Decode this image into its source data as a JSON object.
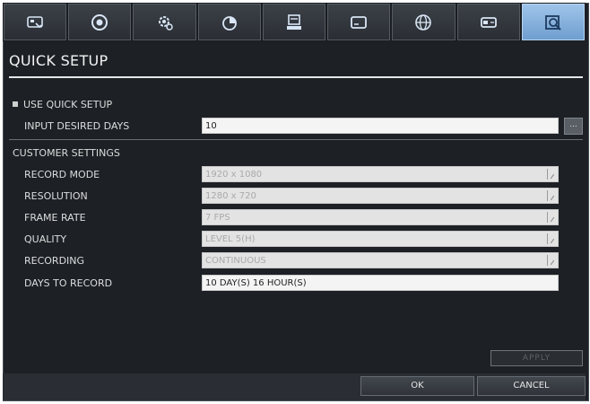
{
  "tabs": [
    {
      "icon": "camera-setup-icon"
    },
    {
      "icon": "record-icon"
    },
    {
      "icon": "settings-gear-icon"
    },
    {
      "icon": "event-pie-icon"
    },
    {
      "icon": "system-monitor-icon"
    },
    {
      "icon": "display-icon"
    },
    {
      "icon": "network-globe-icon"
    },
    {
      "icon": "storage-hdd-icon"
    },
    {
      "icon": "search-icon",
      "active": true
    }
  ],
  "page": {
    "title": "QUICK SETUP"
  },
  "quick_setup": {
    "use_label": "USE QUICK SETUP",
    "days_label": "INPUT DESIRED DAYS",
    "days_value": "10",
    "more_label": "..."
  },
  "customer": {
    "heading": "CUSTOMER SETTINGS",
    "record_mode": {
      "label": "RECORD MODE",
      "value": "1920 x 1080"
    },
    "resolution": {
      "label": "RESOLUTION",
      "value": "1280 x 720"
    },
    "frame_rate": {
      "label": "FRAME RATE",
      "value": "7 FPS"
    },
    "quality": {
      "label": "QUALITY",
      "value": "LEVEL 5(H)"
    },
    "recording": {
      "label": "RECORDING",
      "value": "CONTINUOUS"
    },
    "days_to_record": {
      "label": "DAYS TO RECORD",
      "value": "10 DAY(S) 16 HOUR(S)"
    }
  },
  "buttons": {
    "apply": "APPLY",
    "ok": "OK",
    "cancel": "CANCEL"
  },
  "colors": {
    "active_tab": "#8fb8e3",
    "background": "#1d2126"
  }
}
